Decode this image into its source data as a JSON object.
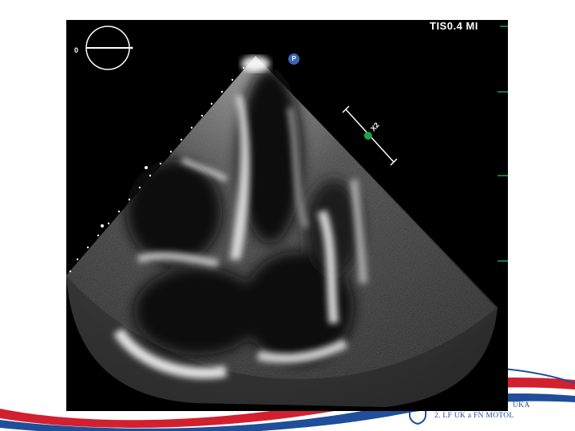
{
  "echo_display": {
    "mode_readout": "TIS0.4  MI",
    "probe_angle": "0",
    "orientation_marker": "P",
    "zoom_label": "X2"
  },
  "branding": {
    "line1": "UKA",
    "line2": "2. LF UK a FN MOTOL"
  },
  "colors": {
    "brand_blue": "#1f4e9a",
    "brand_red": "#d2202f",
    "echo_background": "#000000",
    "marker_green": "#1fa34a"
  }
}
